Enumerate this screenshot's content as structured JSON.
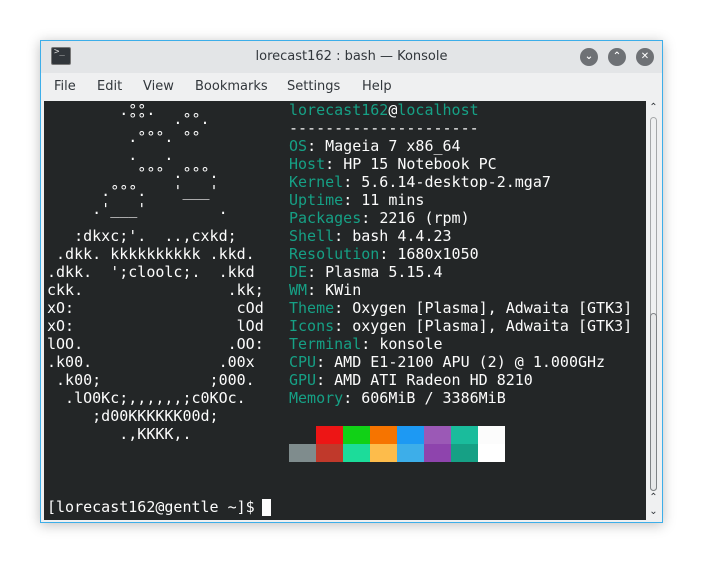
{
  "window": {
    "title": "lorecast162 : bash — Konsole",
    "buttons": [
      "chevron-down-icon",
      "chevron-up-icon",
      "close-icon"
    ]
  },
  "menubar": [
    "File",
    "Edit",
    "View",
    "Bookmarks",
    "Settings",
    "Help"
  ],
  "logo_lines": [
    "        .°°.",
    "         °°   .°°.",
    "         .°°°. °°",
    "         .   .",
    "          °°° .°°°.",
    "      .°°°.   '___'",
    "     .'___'        .",
    "   :dkxc;'.  ..,cxkd;",
    " .dkk. kkkkkkkkkk .kkd.",
    ".dkk.  ';cloolc;.  .kkd",
    "ckk.                .kk;",
    "xO:                  cOd",
    "xO:                  lOd",
    "lOO.                .OO:",
    ".k00.              .00x",
    " .k00;            ;000.",
    "  .lO0Kc;,,,,,,;c0KOc.",
    "     ;d00KKKKKK00d;",
    "        .,KKKK,."
  ],
  "user": {
    "name": "lorecast162",
    "at": "@",
    "host": "localhost"
  },
  "separator": "---------------------",
  "info": [
    {
      "key": "OS",
      "value": "Mageia 7 x86_64"
    },
    {
      "key": "Host",
      "value": "HP 15 Notebook PC"
    },
    {
      "key": "Kernel",
      "value": "5.6.14-desktop-2.mga7"
    },
    {
      "key": "Uptime",
      "value": "11 mins"
    },
    {
      "key": "Packages",
      "value": "2216 (rpm)"
    },
    {
      "key": "Shell",
      "value": "bash 4.4.23"
    },
    {
      "key": "Resolution",
      "value": "1680x1050"
    },
    {
      "key": "DE",
      "value": "Plasma 5.15.4"
    },
    {
      "key": "WM",
      "value": "KWin"
    },
    {
      "key": "Theme",
      "value": "Oxygen [Plasma], Adwaita [GTK3]"
    },
    {
      "key": "Icons",
      "value": "oxygen [Plasma], Adwaita [GTK3]"
    },
    {
      "key": "Terminal",
      "value": "konsole"
    },
    {
      "key": "CPU",
      "value": "AMD E1-2100 APU (2) @ 1.000GHz"
    },
    {
      "key": "GPU",
      "value": "AMD ATI Radeon HD 8210"
    },
    {
      "key": "Memory",
      "value": "606MiB / 3386MiB"
    }
  ],
  "palette_row1": [
    "#232627",
    "#ed1515",
    "#11d116",
    "#f67400",
    "#1d99f3",
    "#9b59b6",
    "#1abc9c",
    "#fcfcfc"
  ],
  "palette_row2": [
    "#7f8c8d",
    "#c0392b",
    "#1cdc9a",
    "#fdbc4b",
    "#3daee9",
    "#8e44ad",
    "#16a085",
    "#ffffff"
  ],
  "prompt": "[lorecast162@gentle ~]$ ",
  "colors": {
    "accent": "#3daee9",
    "terminal_bg": "#232627",
    "key_color": "#16a085",
    "text": "#fcfcfc"
  }
}
